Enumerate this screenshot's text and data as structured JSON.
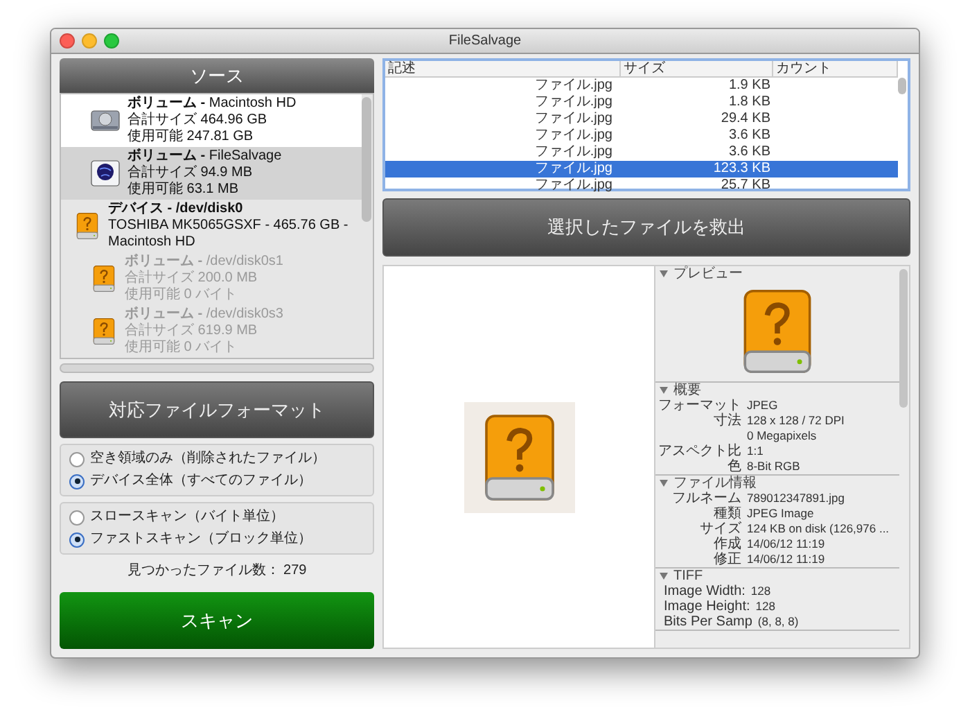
{
  "window": {
    "title": "FileSalvage"
  },
  "source": {
    "title": "ソース",
    "items": [
      {
        "kind": "system-volume",
        "selected": false,
        "disabled": false,
        "name": "**ボリューム -**  Macintosh HD",
        "lines": [
          "合計サイズ 464.96 GB",
          "使用可能 247.81 GB"
        ]
      },
      {
        "kind": "app-volume",
        "selected": true,
        "disabled": false,
        "name": "**ボリューム -**  FileSalvage",
        "lines": [
          "合計サイズ 94.9 MB",
          "使用可能 63.1 MB"
        ]
      },
      {
        "kind": "device",
        "selected": false,
        "disabled": false,
        "name": "**デバイス - /dev/disk0**",
        "lines": [
          "TOSHIBA MK5065GSXF - 465.76 GB - Macintosh HD"
        ]
      },
      {
        "kind": "partition",
        "selected": false,
        "disabled": true,
        "name": "**ボリューム -**  /dev/disk0s1",
        "lines": [
          "合計サイズ 200.0 MB",
          "使用可能 0 バイト"
        ]
      },
      {
        "kind": "partition",
        "selected": false,
        "disabled": true,
        "name": "**ボリューム -**  /dev/disk0s3",
        "lines": [
          "合計サイズ 619.9 MB",
          "使用可能 0 バイト"
        ]
      }
    ]
  },
  "formats_button": "対応ファイルフォーマット",
  "radio_groups": [
    [
      {
        "label": "空き領域のみ（削除されたファイル）",
        "selected": false
      },
      {
        "label": "デバイス全体（すべてのファイル）",
        "selected": true
      }
    ],
    [
      {
        "label": "スロースキャン（バイト単位）",
        "selected": false
      },
      {
        "label": "ファストスキャン（ブロック単位）",
        "selected": true
      }
    ]
  ],
  "found_count": "見つかったファイル数： 279",
  "scan_button": "スキャン",
  "table": {
    "columns": [
      "記述",
      "サイズ",
      "カウント"
    ],
    "rows": [
      {
        "description": "ファイル.jpg",
        "size": "1.9 KB",
        "selected": false
      },
      {
        "description": "ファイル.jpg",
        "size": "1.8 KB",
        "selected": false
      },
      {
        "description": "ファイル.jpg",
        "size": "29.4 KB",
        "selected": false
      },
      {
        "description": "ファイル.jpg",
        "size": "3.6 KB",
        "selected": false
      },
      {
        "description": "ファイル.jpg",
        "size": "3.6 KB",
        "selected": false
      },
      {
        "description": "ファイル.jpg",
        "size": "123.3 KB",
        "selected": true
      },
      {
        "description": "ファイル.jpg",
        "size": "25.7 KB",
        "selected": false
      }
    ]
  },
  "rescue_button": "選択したファイルを救出",
  "inspector": [
    {
      "kind": "preview",
      "title": "プレビュー",
      "expanded": true
    },
    {
      "kind": "fields",
      "title": "概要",
      "expanded": true,
      "fields": [
        {
          "label": "フォーマット",
          "value": "JPEG"
        },
        {
          "label": "寸法",
          "value": "128 x 128 / 72 DPI"
        },
        {
          "value": "0 Megapixels"
        },
        {
          "label": "アスペクト比",
          "value": "1:1"
        },
        {
          "label": "色",
          "value": "8-Bit RGB"
        }
      ]
    },
    {
      "kind": "fields",
      "title": "ファイル情報",
      "expanded": true,
      "fields": [
        {
          "label": "フルネーム",
          "value": "789012347891.jpg"
        },
        {
          "label": "種類",
          "value": "JPEG Image"
        },
        {
          "label": "サイズ",
          "value": "124 KB on disk (126,976 ..."
        },
        {
          "label": "作成",
          "value": "14/06/12 11:19"
        },
        {
          "label": "修正",
          "value": "14/06/12 11:19"
        }
      ]
    },
    {
      "kind": "plain-fields",
      "title": "TIFF",
      "expanded": true,
      "fields": [
        {
          "label": "Image Width:",
          "value": "128"
        },
        {
          "label": "Image Height:",
          "value": "128"
        },
        {
          "label": "Bits Per Samp",
          "value": "(8, 8, 8)"
        }
      ]
    }
  ]
}
